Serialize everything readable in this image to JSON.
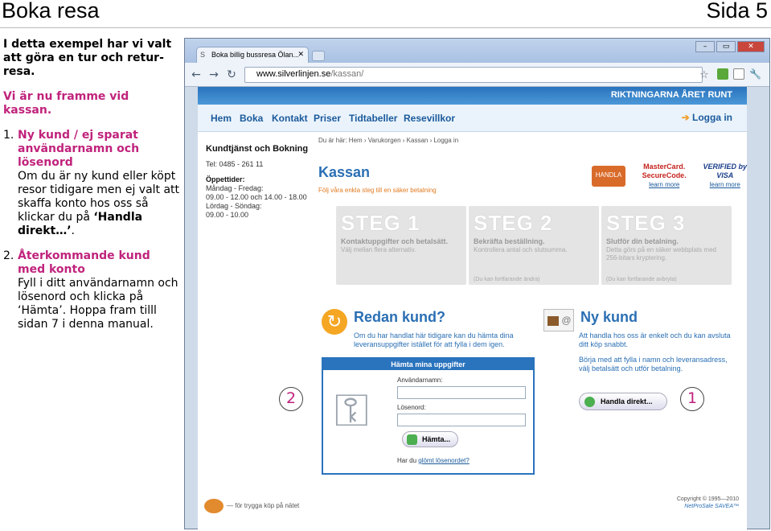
{
  "header": {
    "title": "Boka resa",
    "page": "Sida 5"
  },
  "left": {
    "intro": "I detta exempel har vi valt att göra en tur och retur-resa.",
    "step_note": "Vi är nu framme vid kassan.",
    "items": [
      {
        "num": "1.",
        "head": "Ny kund / ej sparat användarnamn och lösenord",
        "text_a": "Om du är ny kund eller köpt resor tidigare men ej valt att skaffa konto hos oss så klickar du på ",
        "text_b": "‘Handla direkt…’",
        "text_c": "."
      },
      {
        "num": "2.",
        "head": "Återkommande kund med konto",
        "text_a": "Fyll i ditt användarnamn och lösenord och klicka på ‘Hämta’. Hoppa fram tilll sidan 7 i denna manual.",
        "text_b": "",
        "text_c": ""
      }
    ]
  },
  "browser": {
    "tab_title": "Boka billig bussresa Ölan...",
    "url_domain": "www.silverlinjen.se",
    "url_path": "/kassan/",
    "top_strip": "RIKTNINGARNA ÅRET RUNT",
    "menu": [
      "Hem",
      "Boka",
      "Kontakt",
      "Priser",
      "Tidtabeller",
      "Resevillkor"
    ],
    "login": "Logga in",
    "sidebar": {
      "title": "Kundtjänst och Bokning",
      "tel": "Tel: 0485 - 261 11",
      "hours_title": "Öppettider:",
      "hours": [
        "Måndag - Fredag:",
        "09.00 - 12.00 och 14.00 - 18.00",
        "Lördag - Söndag:",
        "09.00 - 10.00"
      ]
    },
    "breadcrumb": "Du är här: Hem › Varukorgen › Kassan › Logga in",
    "kassan_title": "Kassan",
    "kassan_sub": "Följ våra enkla steg till en säker betalning",
    "badges": {
      "trygg": "HANDLA",
      "mastercard": "MasterCard. SecureCode.",
      "visa": "VERIFIED by VISA",
      "more": "learn more"
    },
    "steps": [
      {
        "h": "STEG 1",
        "t": "Kontaktuppgifter och betalsätt.",
        "s": "Välj mellan flera alternativ.",
        "n": ""
      },
      {
        "h": "STEG 2",
        "t": "Bekräfta beställning.",
        "s": "Kontrollera antal och slutsumma.",
        "n": "(Du kan fortfarande ändra)"
      },
      {
        "h": "STEG 3",
        "t": "Slutför din betalning.",
        "s": "Detta görs på en säker webbplats med 256-bitars kryptering.",
        "n": "(Du kan fortfarande avbryta)"
      }
    ],
    "redan": {
      "title": "Redan kund?",
      "text": "Om du har handlat här tidigare kan du hämta dina leveransuppgifter istället för att fylla i dem igen."
    },
    "loginbox": {
      "head": "Hämta mina uppgifter",
      "user_label": "Användarnamn:",
      "pass_label": "Lösenord:",
      "button": "Hämta...",
      "forgot_a": "Har du ",
      "forgot_link": "glömt lösenordet?"
    },
    "ny": {
      "title": "Ny kund",
      "text1": "Att handla hos oss är enkelt och du kan avsluta ditt köp snabbt.",
      "text2": "Börja med att fylla i namn och leveransadress, välj betalsätt och utför betalning.",
      "button": "Handla direkt..."
    },
    "footer_left": "— för trygga köp på nätet",
    "footer_right_1": "Copyright © 1995—2010",
    "footer_right_2": "NetProSale SAVEA™"
  },
  "markers": {
    "one": "1",
    "two": "2"
  }
}
